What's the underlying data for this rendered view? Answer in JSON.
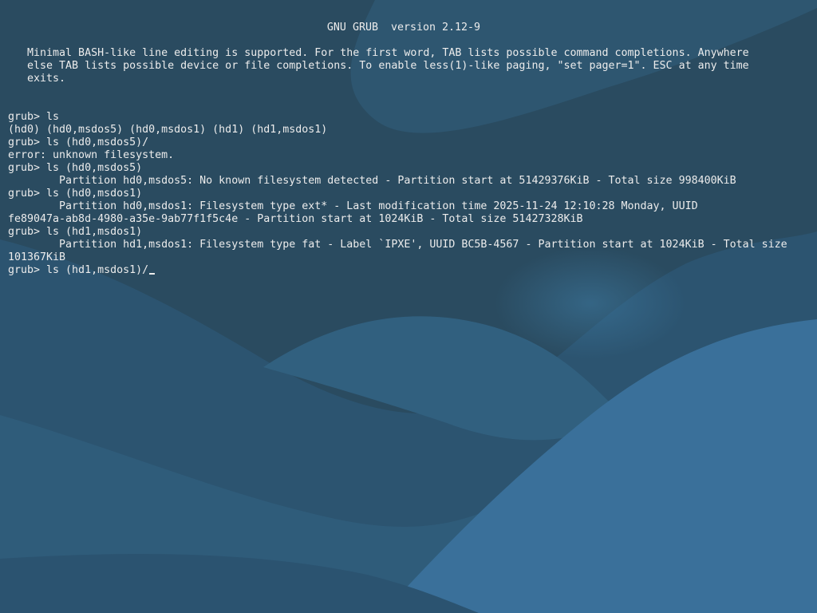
{
  "header": {
    "title": "GNU GRUB  version 2.12-9"
  },
  "help": [
    "   Minimal BASH-like line editing is supported. For the first word, TAB lists possible command completions. Anywhere",
    "   else TAB lists possible device or file completions. To enable less(1)-like paging, \"set pager=1\". ESC at any time",
    "   exits."
  ],
  "console": [
    "grub> ls",
    "(hd0) (hd0,msdos5) (hd0,msdos1) (hd1) (hd1,msdos1)",
    "grub> ls (hd0,msdos5)/",
    "error: unknown filesystem.",
    "grub> ls (hd0,msdos5)",
    "        Partition hd0,msdos5: No known filesystem detected - Partition start at 51429376KiB - Total size 998400KiB",
    "grub> ls (hd0,msdos1)",
    "        Partition hd0,msdos1: Filesystem type ext* - Last modification time 2025-11-24 12:10:28 Monday, UUID",
    "fe89047a-ab8d-4980-a35e-9ab77f1f5c4e - Partition start at 1024KiB - Total size 51427328KiB",
    "grub> ls (hd1,msdos1)",
    "        Partition hd1,msdos1: Filesystem type fat - Label `IPXE', UUID BC5B-4567 - Partition start at 1024KiB - Total size",
    "101367KiB"
  ],
  "prompt": {
    "text": "grub> ls (hd1,msdos1)/"
  },
  "colors": {
    "text": "#ececec",
    "background_dark": "#264458",
    "background_mid": "#2f5a76",
    "background_light": "#3a7098"
  }
}
